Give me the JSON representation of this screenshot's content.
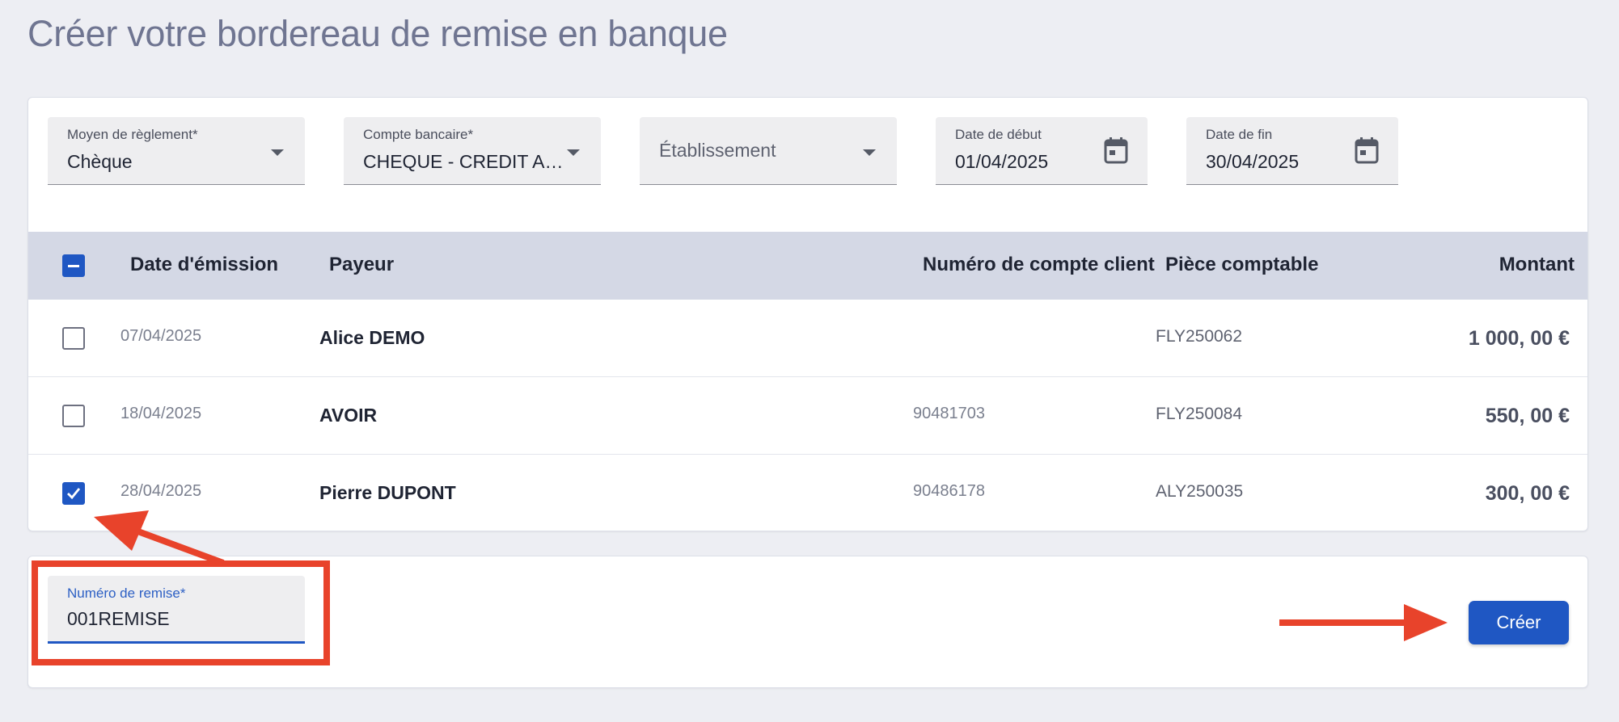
{
  "page": {
    "title": "Créer votre bordereau de remise en banque"
  },
  "filters": {
    "payment_method": {
      "label": "Moyen de règlement*",
      "value": "Chèque"
    },
    "bank_account": {
      "label": "Compte bancaire*",
      "value": "CHEQUE - CREDIT AGRI…"
    },
    "establishment": {
      "placeholder": "Établissement"
    },
    "start_date": {
      "label": "Date de début",
      "value": "01/04/2025"
    },
    "end_date": {
      "label": "Date de fin",
      "value": "30/04/2025"
    }
  },
  "table": {
    "headers": {
      "date": "Date d'émission",
      "payer": "Payeur",
      "account": "Numéro de compte client",
      "piece": "Pièce comptable",
      "amount": "Montant"
    },
    "rows": [
      {
        "date": "07/04/2025",
        "payer": "Alice DEMO",
        "account": "",
        "piece": "FLY250062",
        "amount": "1 000, 00  €",
        "checked": false
      },
      {
        "date": "18/04/2025",
        "payer": "AVOIR",
        "account": "90481703",
        "piece": "FLY250084",
        "amount": "550, 00  €",
        "checked": false
      },
      {
        "date": "28/04/2025",
        "payer": "Pierre DUPONT",
        "account": "90486178",
        "piece": "ALY250035",
        "amount": "300, 00  €",
        "checked": true
      }
    ]
  },
  "remise": {
    "label": "Numéro de remise*",
    "value": "001REMISE"
  },
  "actions": {
    "create_label": "Créer"
  },
  "colors": {
    "primary": "#1f57c3",
    "annotation": "#e8432b",
    "header_bg": "#d4d8e5"
  }
}
